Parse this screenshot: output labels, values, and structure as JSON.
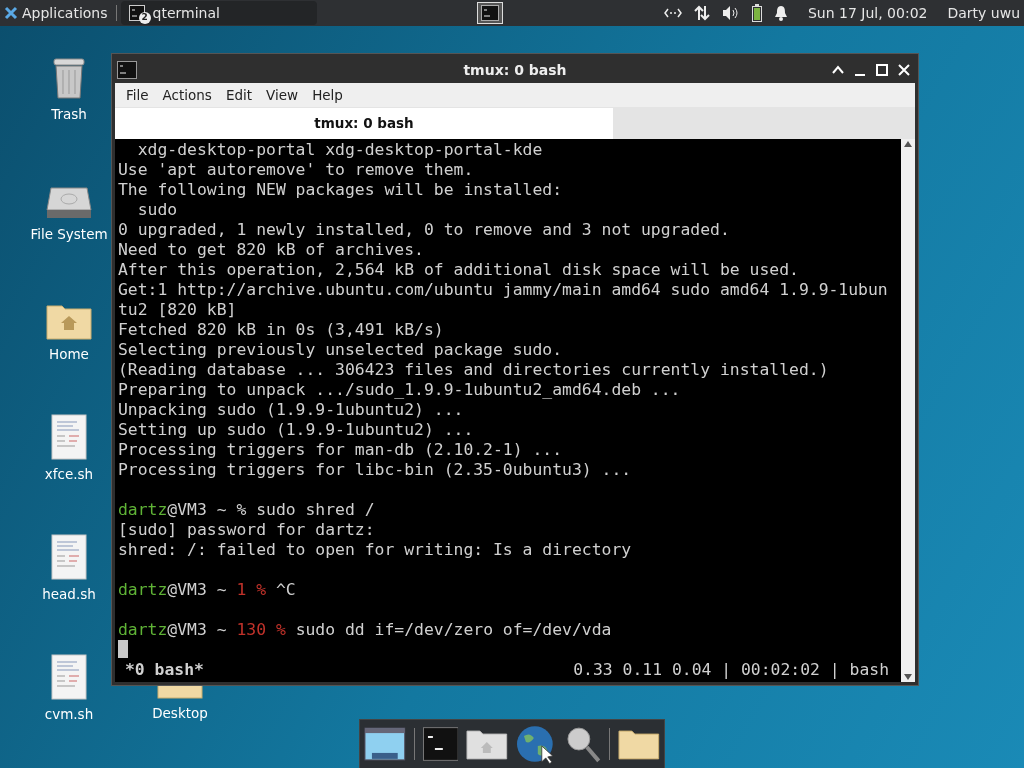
{
  "panel": {
    "apps_menu": "Applications",
    "tasks": [
      {
        "label": "qterminal",
        "count": "2",
        "selected": false
      }
    ],
    "workspace": {
      "selected": true
    },
    "clock": "Sun 17 Jul, 00:02",
    "user": "Darty uwu"
  },
  "desktop_icons": [
    {
      "label": "Trash",
      "kind": "trash"
    },
    {
      "label": "File System",
      "kind": "drive"
    },
    {
      "label": "Home",
      "kind": "home"
    },
    {
      "label": "xfce.sh",
      "kind": "script"
    },
    {
      "label": "head.sh",
      "kind": "script"
    },
    {
      "label": "cvm.sh",
      "kind": "script"
    }
  ],
  "hidden_icon": {
    "label": "Desktop"
  },
  "window": {
    "title": "tmux: 0 bash",
    "menu": [
      "File",
      "Actions",
      "Edit",
      "View",
      "Help"
    ],
    "tabs": [
      {
        "label": "tmux: 0 bash",
        "selected": true
      }
    ],
    "lines": [
      {
        "kind": "text",
        "segments": [
          {
            "kind": "plain",
            "text": "  xdg-desktop-portal xdg-desktop-portal-kde"
          }
        ]
      },
      {
        "kind": "text",
        "segments": [
          {
            "kind": "plain",
            "text": "Use 'apt autoremove' to remove them."
          }
        ]
      },
      {
        "kind": "text",
        "segments": [
          {
            "kind": "plain",
            "text": "The following NEW packages will be installed:"
          }
        ]
      },
      {
        "kind": "text",
        "segments": [
          {
            "kind": "plain",
            "text": "  sudo"
          }
        ]
      },
      {
        "kind": "text",
        "segments": [
          {
            "kind": "plain",
            "text": "0 upgraded, 1 newly installed, 0 to remove and 3 not upgraded."
          }
        ]
      },
      {
        "kind": "text",
        "segments": [
          {
            "kind": "plain",
            "text": "Need to get 820 kB of archives."
          }
        ]
      },
      {
        "kind": "text",
        "segments": [
          {
            "kind": "plain",
            "text": "After this operation, 2,564 kB of additional disk space will be used."
          }
        ]
      },
      {
        "kind": "text",
        "segments": [
          {
            "kind": "plain",
            "text": "Get:1 http://archive.ubuntu.com/ubuntu jammy/main amd64 sudo amd64 1.9.9-1ubun"
          }
        ]
      },
      {
        "kind": "text",
        "segments": [
          {
            "kind": "plain",
            "text": "tu2 [820 kB]"
          }
        ]
      },
      {
        "kind": "text",
        "segments": [
          {
            "kind": "plain",
            "text": "Fetched 820 kB in 0s (3,491 kB/s)"
          }
        ]
      },
      {
        "kind": "text",
        "segments": [
          {
            "kind": "plain",
            "text": "Selecting previously unselected package sudo."
          }
        ]
      },
      {
        "kind": "text",
        "segments": [
          {
            "kind": "plain",
            "text": "(Reading database ... 306423 files and directories currently installed.)"
          }
        ]
      },
      {
        "kind": "text",
        "segments": [
          {
            "kind": "plain",
            "text": "Preparing to unpack .../sudo_1.9.9-1ubuntu2_amd64.deb ..."
          }
        ]
      },
      {
        "kind": "text",
        "segments": [
          {
            "kind": "plain",
            "text": "Unpacking sudo (1.9.9-1ubuntu2) ..."
          }
        ]
      },
      {
        "kind": "text",
        "segments": [
          {
            "kind": "plain",
            "text": "Setting up sudo (1.9.9-1ubuntu2) ..."
          }
        ]
      },
      {
        "kind": "text",
        "segments": [
          {
            "kind": "plain",
            "text": "Processing triggers for man-db (2.10.2-1) ..."
          }
        ]
      },
      {
        "kind": "text",
        "segments": [
          {
            "kind": "plain",
            "text": "Processing triggers for libc-bin (2.35-0ubuntu3) ..."
          }
        ]
      },
      {
        "kind": "blank"
      },
      {
        "kind": "text",
        "segments": [
          {
            "kind": "user",
            "text": "dartz"
          },
          {
            "kind": "plain",
            "text": "@VM3 ~ % sudo shred /"
          }
        ]
      },
      {
        "kind": "text",
        "segments": [
          {
            "kind": "plain",
            "text": "[sudo] password for dartz:"
          }
        ]
      },
      {
        "kind": "text",
        "segments": [
          {
            "kind": "plain",
            "text": "shred: /: failed to open for writing: Is a directory"
          }
        ]
      },
      {
        "kind": "blank"
      },
      {
        "kind": "text",
        "segments": [
          {
            "kind": "user",
            "text": "dartz"
          },
          {
            "kind": "plain",
            "text": "@VM3 ~ "
          },
          {
            "kind": "exit",
            "text": "1 %"
          },
          {
            "kind": "plain",
            "text": " ^C"
          }
        ]
      },
      {
        "kind": "blank"
      },
      {
        "kind": "text",
        "segments": [
          {
            "kind": "user",
            "text": "dartz"
          },
          {
            "kind": "plain",
            "text": "@VM3 ~ "
          },
          {
            "kind": "exit",
            "text": "130 %"
          },
          {
            "kind": "plain",
            "text": " sudo dd if=/dev/zero of=/dev/vda"
          }
        ]
      }
    ],
    "status": {
      "left": "*0 bash*",
      "right": "0.33 0.11 0.04 | 00:02:02 | bash"
    }
  }
}
